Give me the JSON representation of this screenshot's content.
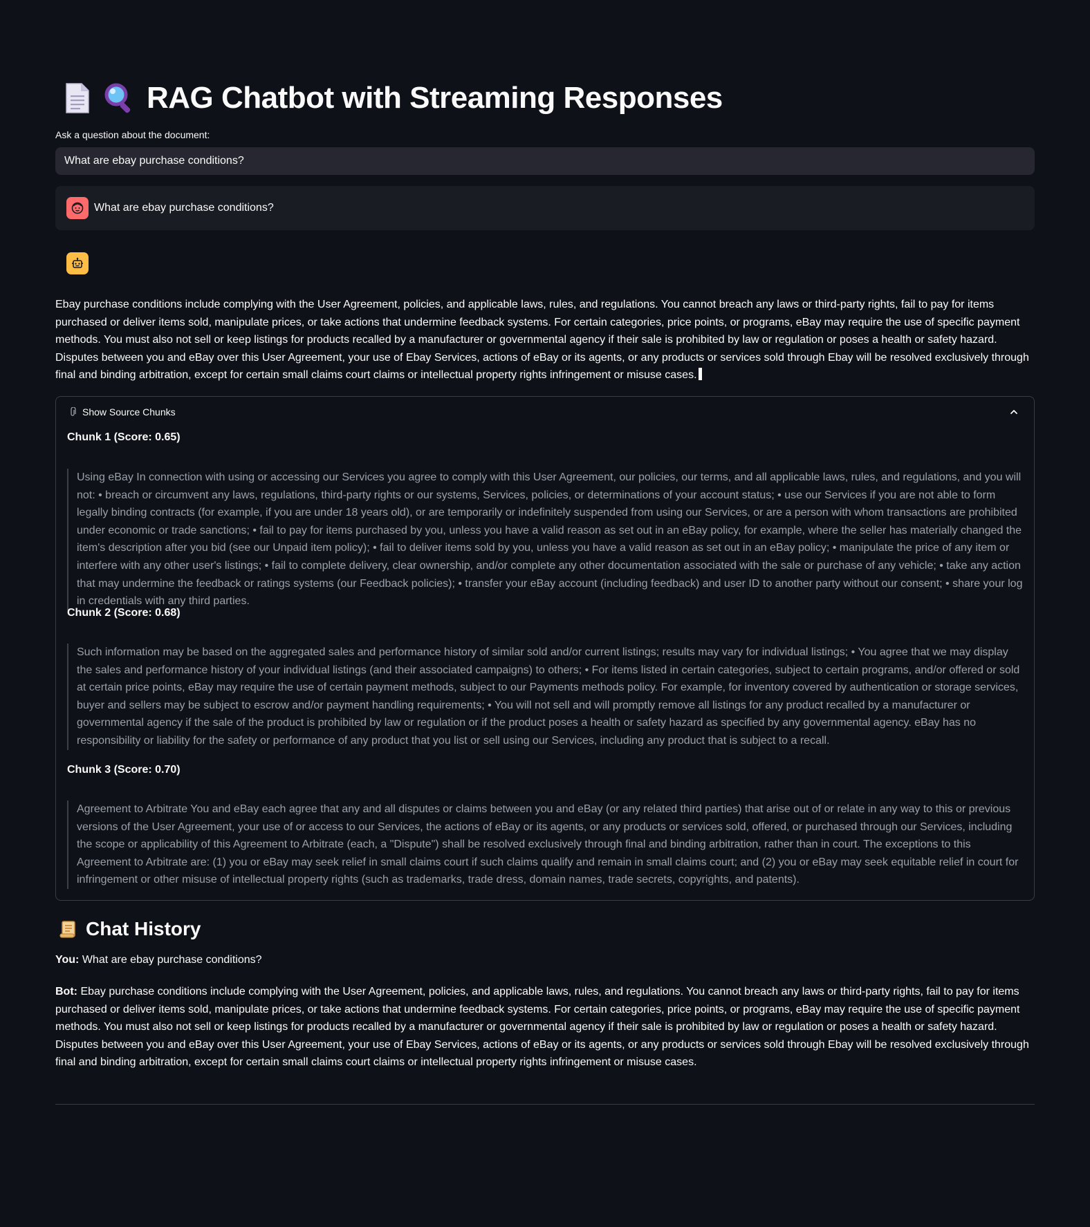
{
  "app": {
    "title": "RAG Chatbot with Streaming Responses",
    "title_icons": [
      "document-icon",
      "magnifier-icon"
    ]
  },
  "query": {
    "label": "Ask a question about the document:",
    "value": "What are ebay purchase conditions?"
  },
  "chat": {
    "user_message": "What are ebay purchase conditions?",
    "user_avatar": "user-face-icon",
    "bot_avatar": "robot-icon",
    "bot_answer": "Ebay purchase conditions include complying with the User Agreement, policies, and applicable laws, rules, and regulations. You cannot breach any laws or third-party rights, fail to pay for items purchased or deliver items sold, manipulate prices, or take actions that undermine feedback systems. For certain categories, price points, or programs, eBay may require the use of specific payment methods. You must also not sell or keep listings for products recalled by a manufacturer or governmental agency if their sale is prohibited by law or regulation or poses a health or safety hazard. Disputes between you and eBay over this User Agreement, your use of Ebay Services, actions of eBay or its agents, or any products or services sold through Ebay will be resolved exclusively through final and binding arbitration, except for certain small claims court claims or intellectual property rights infringement or misuse cases."
  },
  "sources": {
    "label": "Show Source Chunks",
    "icon": "paperclip-icon",
    "expanded": true,
    "chunks": [
      {
        "title": "Chunk 1 (Score: 0.65)",
        "text": "Using eBay In connection with using or accessing our Services you agree to comply with this User Agreement, our policies, our terms, and all applicable laws, rules, and regulations, and you will not: • breach or circumvent any laws, regulations, third-party rights or our systems, Services, policies, or determinations of your account status; • use our Services if you are not able to form legally binding contracts (for example, if you are under 18 years old), or are temporarily or indefinitely suspended from using our Services, or are a person with whom transactions are prohibited under economic or trade sanctions; • fail to pay for items purchased by you, unless you have a valid reason as set out in an eBay policy, for example, where the seller has materially changed the item's description after you bid (see our Unpaid item policy); • fail to deliver items sold by you, unless you have a valid reason as set out in an eBay policy; • manipulate the price of any item or interfere with any other user's listings; • fail to complete delivery, clear ownership, and/or complete any other documentation associated with the sale or purchase of any vehicle; • take any action that may undermine the feedback or ratings systems (our Feedback policies); • transfer your eBay account (including feedback) and user ID to another party without our consent; • share your log in credentials with any third parties."
      },
      {
        "title": "Chunk 2 (Score: 0.68)",
        "text": "Such information may be based on the aggregated sales and performance history of similar sold and/or current listings; results may vary for individual listings; • You agree that we may display the sales and performance history of your individual listings (and their associated campaigns) to others; • For items listed in certain categories, subject to certain programs, and/or offered or sold at certain price points, eBay may require the use of certain payment methods, subject to our Payments methods policy. For example, for inventory covered by authentication or storage services, buyer and sellers may be subject to escrow and/or payment handling requirements; • You will not sell and will promptly remove all listings for any product recalled by a manufacturer or governmental agency if the sale of the product is prohibited by law or regulation or if the product poses a health or safety hazard as specified by any governmental agency. eBay has no responsibility or liability for the safety or performance of any product that you list or sell using our Services, including any product that is subject to a recall."
      },
      {
        "title": "Chunk 3 (Score: 0.70)",
        "text": "Agreement to Arbitrate You and eBay each agree that any and all disputes or claims between you and eBay (or any related third parties) that arise out of or relate in any way to this or previous versions of the User Agreement, your use of or access to our Services, the actions of eBay or its agents, or any products or services sold, offered, or purchased through our Services, including the scope or applicability of this Agreement to Arbitrate (each, a \"Dispute\") shall be resolved exclusively through final and binding arbitration, rather than in court. The exceptions to this Agreement to Arbitrate are: (1) you or eBay may seek relief in small claims court if such claims qualify and remain in small claims court; and (2) you or eBay may seek equitable relief in court for infringement or other misuse of intellectual property rights (such as trademarks, trade dress, domain names, trade secrets, copyrights, and patents)."
      }
    ]
  },
  "history": {
    "title": "Chat History",
    "icon": "scroll-icon",
    "you_label": "You:",
    "you_text": "What are ebay purchase conditions?",
    "bot_label": "Bot:",
    "bot_text": "Ebay purchase conditions include complying with the User Agreement, policies, and applicable laws, rules, and regulations. You cannot breach any laws or third-party rights, fail to pay for items purchased or deliver items sold, manipulate prices, or take actions that undermine feedback systems. For certain categories, price points, or programs, eBay may require the use of specific payment methods. You must also not sell or keep listings for products recalled by a manufacturer or governmental agency if their sale is prohibited by law or regulation or poses a health or safety hazard. Disputes between you and eBay over this User Agreement, your use of Ebay Services, actions of eBay or its agents, or any products or services sold through Ebay will be resolved exclusively through final and binding arbitration, except for certain small claims court claims or intellectual property rights infringement or misuse cases."
  },
  "colors": {
    "background": "#0e1117",
    "input_bg": "#262730",
    "chat_bg": "#1a1c24",
    "user_avatar": "#ff6b6b",
    "bot_avatar": "#ffbd45",
    "muted_text": "#9aa0aa",
    "border": "#3a3d46"
  }
}
